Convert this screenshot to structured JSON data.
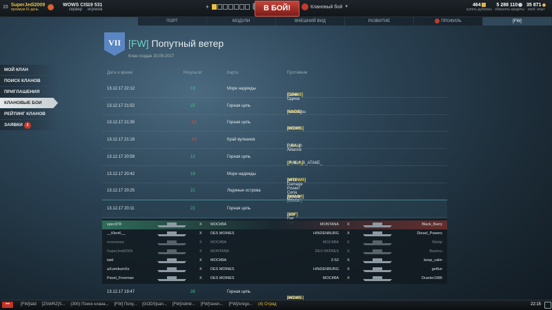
{
  "topbar": {
    "level": "15",
    "account_name": "SuperJedi2009",
    "account_sub": "премиум 61 день",
    "server": "WOWS CIS",
    "server_sub": "сервер",
    "players": "19 531",
    "players_sub": "игроков",
    "battle_button": "В БОЙ!",
    "battle_mode": "Клановый бой",
    "doubloons": "464",
    "doubloons_sub": "купить дублоны",
    "credits": "5 288 110",
    "credits_sub": "обменять кредиты",
    "free_xp": "35 871",
    "free_xp_sub": "своб. опыт",
    "doubloon_color": "#e3b744",
    "credit_color": "#c9d2d8",
    "xp_color": "#e8c04a"
  },
  "nav": [
    "ПОРТ",
    "МОДУЛИ",
    "ВНЕШНИЙ ВИД",
    "РАЗВИТИЕ",
    "ПРОФИЛЬ",
    "[FW]"
  ],
  "clan": {
    "tier": "VII",
    "tag": "[FW]",
    "name": "Попутный ветер",
    "created": "Клан создан 20.09.2017"
  },
  "sidebar": {
    "items": [
      {
        "label": "МОЙ КЛАН"
      },
      {
        "label": "ПОИСК КЛАНОВ"
      },
      {
        "label": "ПРИГЛАШЕНИЯ"
      },
      {
        "label": "КЛАНОВЫЕ БОИ"
      },
      {
        "label": "РЕЙТИНГ КЛАНОВ"
      },
      {
        "label": "ЗАЯВКИ",
        "count": "3"
      }
    ]
  },
  "table": {
    "headers": [
      "Дата и время",
      "Результат",
      "Карта",
      "Противник"
    ],
    "rows": [
      {
        "date": "13.12.17 22:12",
        "result": "19",
        "win": true,
        "map": "Море надежды",
        "tag": "[ODINS]",
        "opponent": "Сыны Одина"
      },
      {
        "date": "13.12.17 21:52",
        "result": "22",
        "win": true,
        "map": "Горная цепь",
        "tag": "[NNDE]",
        "opponent": "Nanodesu"
      },
      {
        "date": "13.12.17 21:35",
        "result": "-16",
        "win": false,
        "map": "Горная цепь",
        "tag": "[WOWS]",
        "opponent": "WOWS"
      },
      {
        "date": "13.12.17 21:18",
        "result": "-16",
        "win": false,
        "map": "Край вулканов",
        "tag": "[_RA_]",
        "opponent": "Russian Alliance"
      },
      {
        "date": "13.12.17 20:59",
        "result": "12",
        "win": true,
        "map": "Горная цепь",
        "tag": "[P_B_A]",
        "opponent": "_РАКИ_В_АТАКЕ_"
      },
      {
        "date": "13.12.17 20:42",
        "result": "19",
        "win": true,
        "map": "Море надежды",
        "tag": "[WTPWR]",
        "opponent": "White Damage Power/Сила Белого Урона"
      },
      {
        "date": "13.12.17 20:25",
        "result": "21",
        "win": true,
        "map": "Ледяные острова",
        "tag": "[NYASH]",
        "opponent": "Дняши [PRIDE]"
      },
      {
        "date": "13.12.17 20:11",
        "result": "22",
        "win": true,
        "map": "Горная цепь",
        "tag": "[JGF]",
        "opponent": "Just Get Fun"
      }
    ],
    "last_row": {
      "date": "13.12.17 19:47",
      "result": "28",
      "win": true,
      "map": "Горная цепь",
      "tag": "[WOWS]",
      "opponent": "WOWS"
    }
  },
  "detail": [
    {
      "player": "spec978",
      "ship": "МОСКВА",
      "enemy_ship": "MONTANA",
      "enemy": "Black_Barry",
      "dead": false
    },
    {
      "player": "__KlenK__",
      "ship": "DES MOINES",
      "enemy_ship": "HINDENBURG",
      "enemy": "Diesel_Powers",
      "dead": false
    },
    {
      "player": "monoreee",
      "ship": "МОСКВА",
      "enemy_ship": "МОСКВА",
      "enemy": "Mship",
      "dead": true
    },
    {
      "player": "SuperJedi2009",
      "ship": "MONTANA",
      "enemy_ship": "DES MOINES",
      "enemy": "Bashou",
      "dead": true
    },
    {
      "player": "tatd",
      "ship": "МОСКВА",
      "enemy_ship": "Z-52",
      "enemy": "keep_calm",
      "dead": false
    },
    {
      "player": "aXumikumXx",
      "ship": "DES MOINES",
      "enemy_ship": "HINDENBURG",
      "enemy": "getfun",
      "dead": false
    },
    {
      "player": "Pavel_Freeman",
      "ship": "DES MOINES",
      "enemy_ship": "МОСКВА",
      "enemy": "Draxler1990",
      "dead": false
    }
  ],
  "versus": "X",
  "taskbar": {
    "menu": "•••",
    "items": [
      "[FW]tatd",
      "[ZSWRZ]S...",
      "(300) Поиск клана...",
      "[FW] Попу...",
      "[GODS]san...",
      "[FW]Admir...",
      "[FW]raven...",
      "[FW]Amigo...",
      "(4) Отряд"
    ],
    "time": "22:15"
  }
}
